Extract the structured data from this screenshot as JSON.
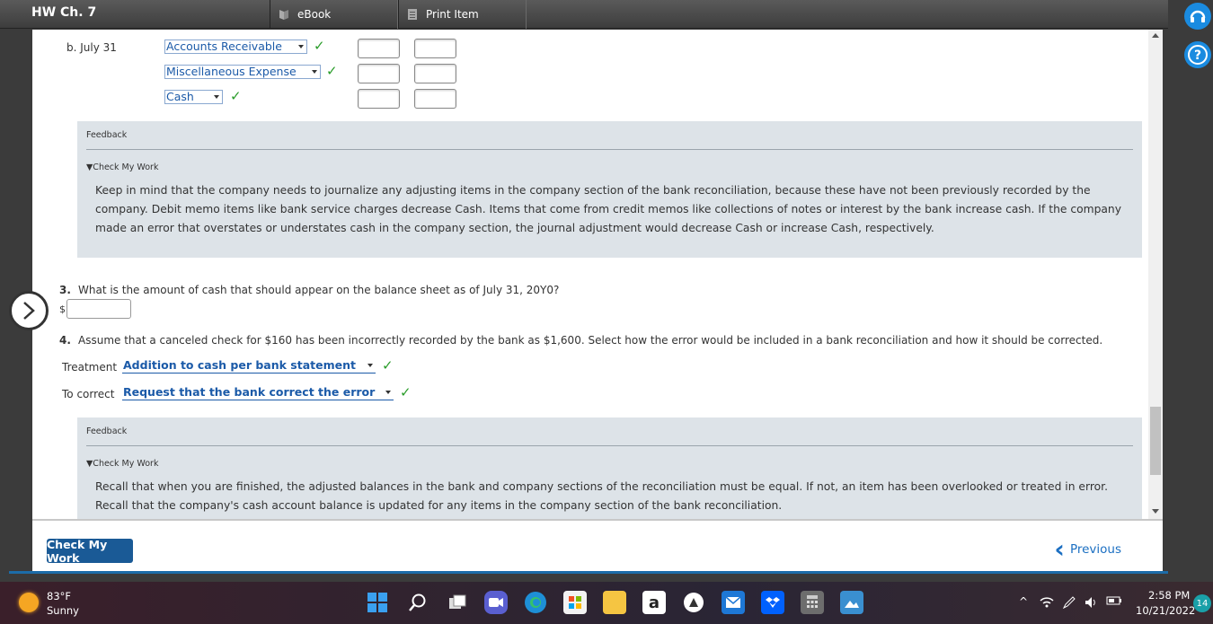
{
  "header": {
    "title": "HW Ch. 7",
    "ebook_label": "eBook",
    "print_label": "Print Item"
  },
  "entry_b": {
    "label": "b. July 31",
    "accounts": [
      {
        "value": "Accounts Receivable"
      },
      {
        "value": "Miscellaneous Expense"
      },
      {
        "value": "Cash"
      }
    ]
  },
  "feedback1": {
    "title": "Feedback",
    "toggle": "▼Check My Work",
    "body": "Keep in mind that the company needs to journalize any adjusting items in the company section of the bank reconciliation, because these have not been previously recorded by the company. Debit memo items like bank service charges decrease Cash. Items that come from credit memos like collections of notes or interest by the bank increase cash. If the company made an error that overstates or understates cash in the company section, the journal adjustment would decrease Cash or increase Cash, respectively."
  },
  "q3": {
    "number": "3.",
    "text": "What is the amount of cash that should appear on the balance sheet as of July 31, 20Y0?",
    "currency": "$",
    "value": ""
  },
  "q4": {
    "number": "4.",
    "text": "Assume that a canceled check for $160 has been incorrectly recorded by the bank as $1,600. Select how the error would be included in a bank reconciliation and how it should be corrected.",
    "treatment_label": "Treatment",
    "treatment_value": "Addition to cash per bank statement",
    "correct_label": "To correct",
    "correct_value": "Request that the bank correct the error"
  },
  "feedback2": {
    "title": "Feedback",
    "toggle": "▼Check My Work",
    "body": "Recall that when you are finished, the adjusted balances in the bank and company sections of the reconciliation must be equal. If not, an item has been overlooked or treated in error. Recall that the company's cash account balance is updated for any items in the company section of the bank reconciliation."
  },
  "footer": {
    "check_label": "Check My Work",
    "previous_label": "Previous"
  },
  "taskbar": {
    "temp": "83°F",
    "weather": "Sunny",
    "time": "2:58 PM",
    "date": "10/21/2022",
    "notifications": "14"
  },
  "icons": {
    "check": "check-icon",
    "help": "help-icon",
    "headset": "headset-icon"
  },
  "colors": {
    "accent": "#1b5aa8",
    "check_green": "#2a9d2a",
    "button": "#1a5a96"
  }
}
